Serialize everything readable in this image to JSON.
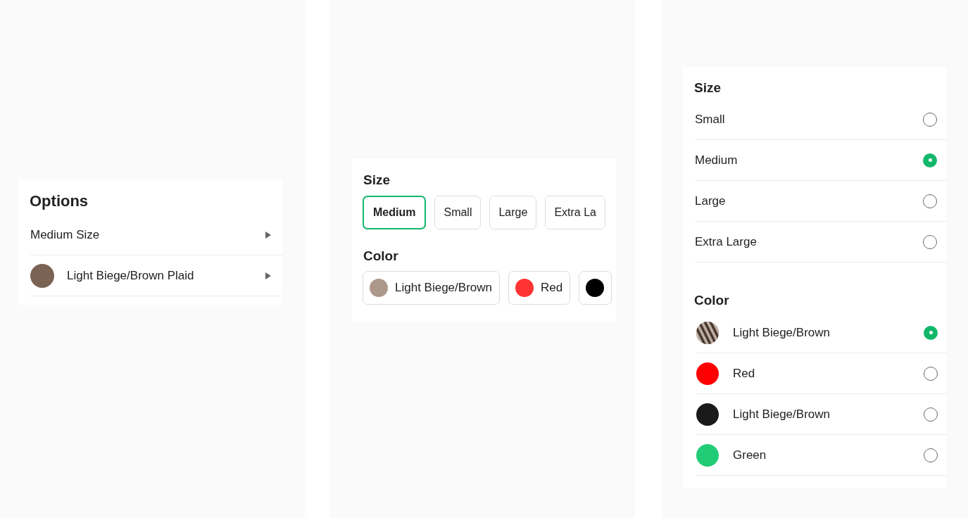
{
  "options_card": {
    "title": "Options",
    "rows": [
      {
        "label": "Medium Size"
      },
      {
        "label": "Light Biege/Brown Plaid",
        "color": "#7a6353"
      }
    ]
  },
  "chip_card": {
    "size": {
      "title": "Size",
      "options": [
        {
          "label": "Medium",
          "selected": true
        },
        {
          "label": "Small",
          "selected": false
        },
        {
          "label": "Large",
          "selected": false
        },
        {
          "label": "Extra La",
          "selected": false
        }
      ]
    },
    "color": {
      "title": "Color",
      "options": [
        {
          "label": "Light Biege/Brown",
          "color": "#ad978b",
          "selected": false
        },
        {
          "label": "Red",
          "color": "#ff3333",
          "selected": false
        },
        {
          "color": "#000000",
          "selected": false
        }
      ]
    }
  },
  "radio_card": {
    "size": {
      "title": "Size",
      "options": [
        {
          "label": "Small",
          "selected": false
        },
        {
          "label": "Medium",
          "selected": true
        },
        {
          "label": "Large",
          "selected": false
        },
        {
          "label": "Extra Large",
          "selected": false
        }
      ]
    },
    "color": {
      "title": "Color",
      "options": [
        {
          "kind": "pattern",
          "label": "Light Biege/Brown",
          "selected": true
        },
        {
          "kind": "solid",
          "label": "Red",
          "color": "#ff0000",
          "selected": false
        },
        {
          "kind": "solid",
          "label": "Light Biege/Brown",
          "color": "#1a1a1a",
          "selected": false
        },
        {
          "kind": "solid",
          "label": "Green",
          "color": "#22cc77",
          "selected": false
        }
      ]
    }
  }
}
